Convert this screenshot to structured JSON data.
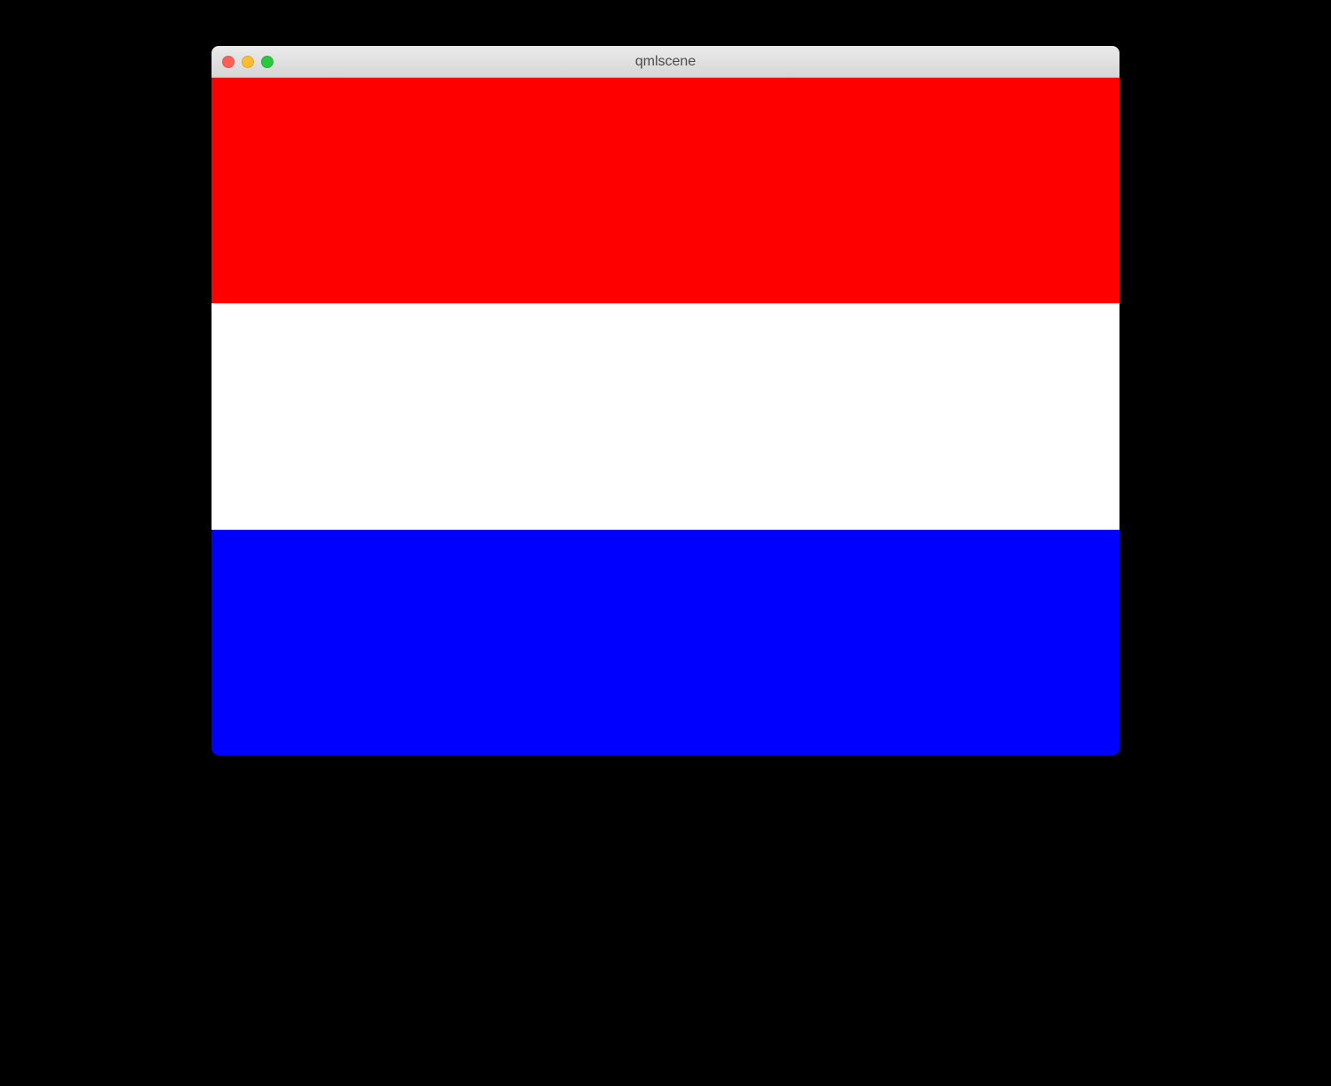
{
  "window": {
    "title": "qmlscene"
  },
  "stripes": [
    {
      "color": "#ff0000"
    },
    {
      "color": "#ffffff"
    },
    {
      "color": "#0000ff"
    }
  ]
}
